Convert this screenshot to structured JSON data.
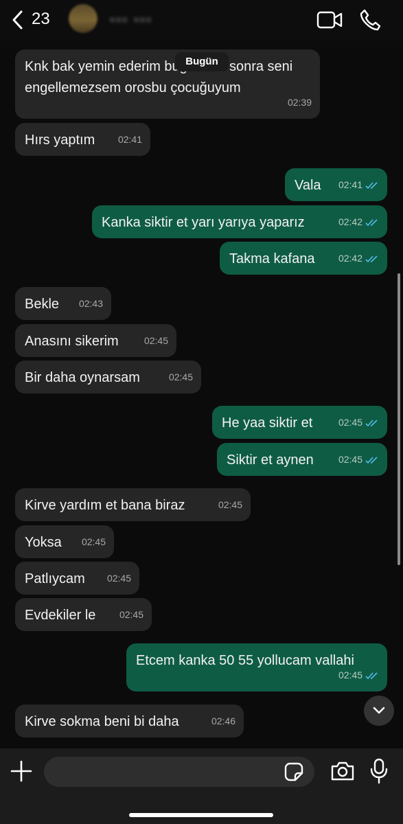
{
  "header": {
    "unread_count": "23",
    "contact_name": "▪▪▪ ▪▪▪"
  },
  "date_separator": "Bugün",
  "messages": [
    {
      "dir": "in",
      "text": "Knk bak yemin ederim bugünden sonra seni engellemezsem orosbu çocuğuyum",
      "time": "02:39"
    },
    {
      "dir": "in",
      "text": "Hırs yaptım",
      "time": "02:41"
    },
    {
      "dir": "out",
      "text": "Vala",
      "time": "02:41"
    },
    {
      "dir": "out",
      "text": "Kanka siktir et yarı yarıya yaparız",
      "time": "02:42"
    },
    {
      "dir": "out",
      "text": "Takma kafana",
      "time": "02:42"
    },
    {
      "dir": "in",
      "text": "Bekle",
      "time": "02:43"
    },
    {
      "dir": "in",
      "text": "Anasını sikerim",
      "time": "02:45"
    },
    {
      "dir": "in",
      "text": "Bir daha oynarsam",
      "time": "02:45"
    },
    {
      "dir": "out",
      "text": "He yaa siktir et",
      "time": "02:45"
    },
    {
      "dir": "out",
      "text": "Siktir et aynen",
      "time": "02:45"
    },
    {
      "dir": "in",
      "text": "Kirve yardım et bana biraz",
      "time": "02:45"
    },
    {
      "dir": "in",
      "text": "Yoksa",
      "time": "02:45"
    },
    {
      "dir": "in",
      "text": "Patlıycam",
      "time": "02:45"
    },
    {
      "dir": "in",
      "text": "Evdekiler le",
      "time": "02:45"
    },
    {
      "dir": "out",
      "text": "Etcem kanka 50 55 yollucam vallahi",
      "time": "02:45"
    },
    {
      "dir": "in",
      "text": "Kirve sokma beni bi daha",
      "time": "02:46"
    }
  ],
  "composer": {
    "input_value": ""
  },
  "colors": {
    "background": "#0b0b0b",
    "incoming_bubble": "#262626",
    "outgoing_bubble": "#0f5c45",
    "read_ticks": "#53bdeb"
  },
  "icons": [
    "back-icon",
    "video-call-icon",
    "phone-call-icon",
    "read-ticks-icon",
    "chevron-down-icon",
    "plus-icon",
    "sticker-icon",
    "camera-icon",
    "microphone-icon"
  ]
}
